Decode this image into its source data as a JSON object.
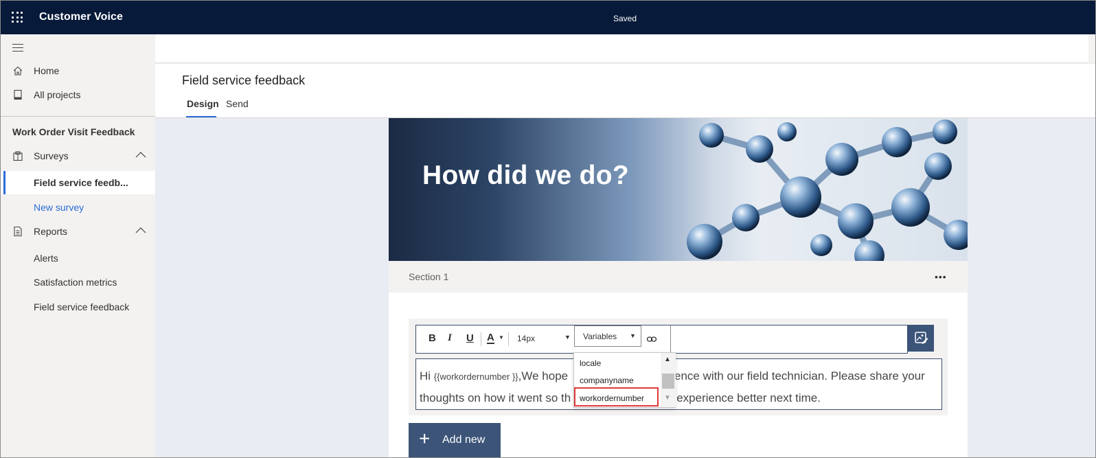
{
  "topbar": {
    "app_title": "Customer Voice",
    "status": "Saved"
  },
  "sidebar": {
    "home": "Home",
    "all_projects": "All projects",
    "project_title": "Work Order Visit Feedback",
    "surveys": "Surveys",
    "surveys_items": [
      "Field service feedb...",
      "New survey"
    ],
    "reports": "Reports",
    "reports_items": [
      "Alerts",
      "Satisfaction metrics",
      "Field service feedback"
    ]
  },
  "header": {
    "title": "Field service feedback",
    "tabs": [
      "Design",
      "Send"
    ]
  },
  "survey": {
    "banner_title": "How did we do?",
    "section_label": "Section 1",
    "more_icon": "ellipsis-icon",
    "toolbar": {
      "bold": "B",
      "italic": "I",
      "underline": "U",
      "font_color": "A",
      "font_size": "14px",
      "variables_label": "Variables"
    },
    "body_text": {
      "greeting": "Hi ",
      "token": "{{workordernumber }}",
      "line1_rest": ",We hope",
      "line1_tail": "erience with our field technician. Please share your",
      "line2_start": "thoughts on how it went so th",
      "line2_tail": "experience better next time."
    },
    "variables_options": [
      "locale",
      "companyname",
      "workordernumber"
    ],
    "selected_variable": "workordernumber",
    "add_new": "Add new"
  },
  "colors": {
    "topbar": "#071a3a",
    "accent": "#2b6cd8",
    "button": "#3b5478",
    "highlight": "#e0393a"
  }
}
